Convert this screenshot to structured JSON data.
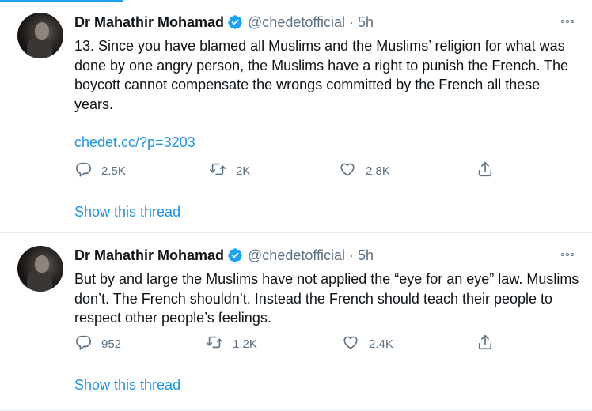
{
  "tweets": [
    {
      "author_name": "Dr Mahathir Mohamad",
      "handle": "@chedetofficial",
      "separator": "·",
      "time": "5h",
      "text": "13. Since you have blamed all Muslims and the Muslims’ religion for what was done by one angry person, the Muslims have a right to punish the French. The boycott cannot compensate the wrongs committed by the French all these years.",
      "link": "chedet.cc/?p=3203",
      "reply_count": "2.5K",
      "retweet_count": "2K",
      "like_count": "2.8K",
      "show_thread": "Show this thread"
    },
    {
      "author_name": "Dr Mahathir Mohamad",
      "handle": "@chedetofficial",
      "separator": "·",
      "time": "5h",
      "text": "But by and large the Muslims have not applied the “eye for an eye” law. Muslims don’t. The French shouldn’t. Instead the French should teach their people to respect other people’s feelings.",
      "reply_count": "952",
      "retweet_count": "1.2K",
      "like_count": "2.4K",
      "show_thread": "Show this thread"
    }
  ],
  "icons": {
    "verified": "verified-badge-icon",
    "more": "more-options-icon",
    "reply": "reply-icon",
    "retweet": "retweet-icon",
    "like": "like-icon",
    "share": "share-icon"
  },
  "colors": {
    "accent": "#1da1f2",
    "link": "#1b95e0",
    "secondary_text": "#5b7083",
    "primary_text": "#0f1419"
  }
}
